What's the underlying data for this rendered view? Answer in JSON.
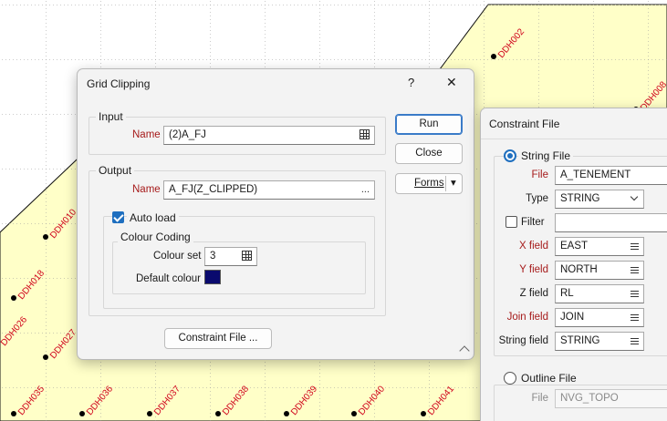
{
  "map": {
    "holes": [
      {
        "id": "DDH002"
      },
      {
        "id": "DDH008"
      },
      {
        "id": "DDH010"
      },
      {
        "id": "DDH018"
      },
      {
        "id": "DDH026"
      },
      {
        "id": "DDH027"
      },
      {
        "id": "DDH035"
      },
      {
        "id": "DDH036"
      },
      {
        "id": "DDH037"
      },
      {
        "id": "DDH038"
      },
      {
        "id": "DDH039"
      },
      {
        "id": "DDH040"
      },
      {
        "id": "DDH041"
      }
    ],
    "fill_color": "#ffffc8"
  },
  "grid_clipping": {
    "title": "Grid Clipping",
    "help_glyph": "?",
    "close_glyph": "✕",
    "input": {
      "group_label": "Input",
      "name_label": "Name",
      "name_value": "(2)A_FJ"
    },
    "output": {
      "group_label": "Output",
      "name_label": "Name",
      "name_value": "A_FJ(Z_CLIPPED)",
      "name_button": "...",
      "auto_load_label": "Auto load",
      "auto_load_checked": true,
      "colour_coding": {
        "group_label": "Colour Coding",
        "colour_set_label": "Colour set",
        "colour_set_value": "3",
        "default_colour_label": "Default colour",
        "default_colour": "#0a0a6e"
      }
    },
    "buttons": {
      "run": "Run",
      "close": "Close",
      "forms": "Forms",
      "forms_arrow": "▾",
      "constraint_file": "Constraint File ..."
    }
  },
  "constraint_file": {
    "title": "Constraint File",
    "string_file": {
      "label": "String File",
      "selected": true,
      "file_label": "File",
      "file_value": "A_TENEMENT",
      "type_label": "Type",
      "type_value": "STRING",
      "filter_label": "Filter",
      "filter_value": "",
      "x_field_label": "X field",
      "x_field_value": "EAST",
      "y_field_label": "Y field",
      "y_field_value": "NORTH",
      "z_field_label": "Z field",
      "z_field_value": "RL",
      "join_field_label": "Join field",
      "join_field_value": "JOIN",
      "string_field_label": "String field",
      "string_field_value": "STRING"
    },
    "outline_file": {
      "label": "Outline File",
      "selected": false,
      "file_label": "File",
      "file_value": "NVG_TOPO"
    }
  }
}
